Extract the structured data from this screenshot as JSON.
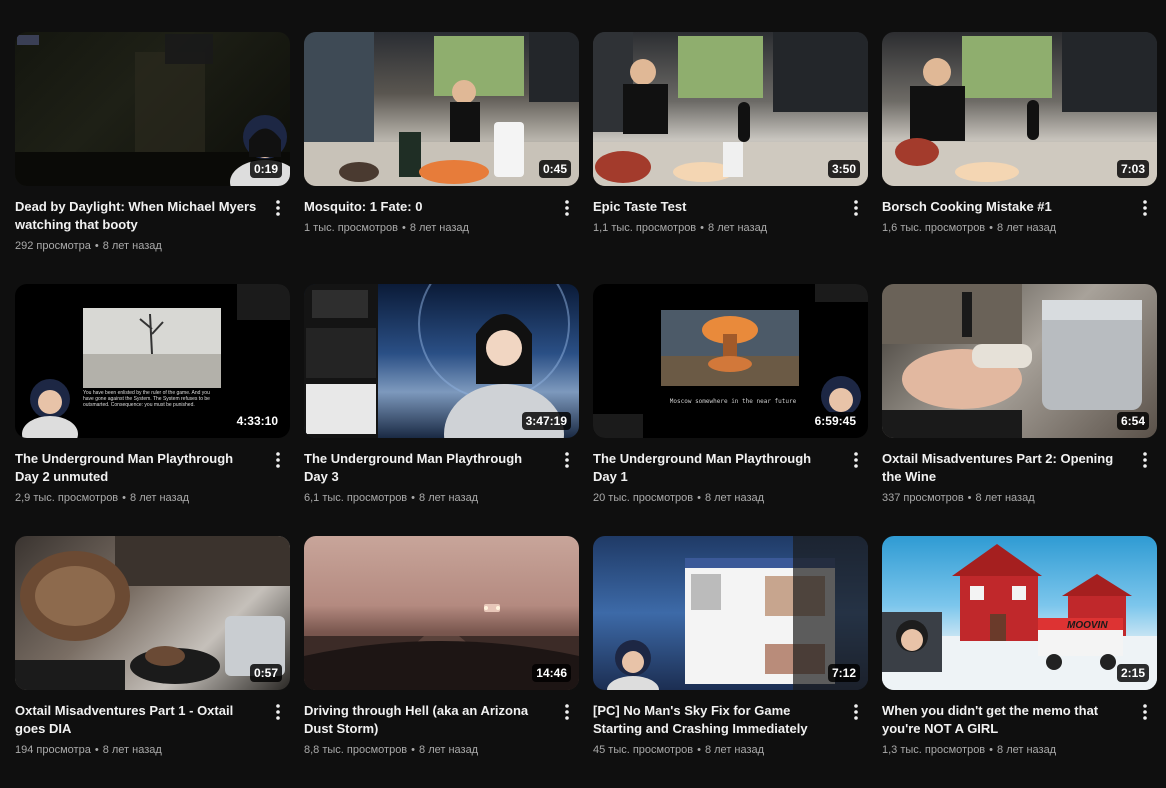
{
  "videos": [
    {
      "title": "Dead by Daylight: When Michael Myers watching that booty",
      "views": "292 просмотра",
      "age": "8 лет назад",
      "duration": "0:19"
    },
    {
      "title": "Mosquito: 1 Fate: 0",
      "views": "1 тыс. просмотров",
      "age": "8 лет назад",
      "duration": "0:45"
    },
    {
      "title": "Epic Taste Test",
      "views": "1,1 тыс. просмотров",
      "age": "8 лет назад",
      "duration": "3:50"
    },
    {
      "title": "Borsch Cooking Mistake #1",
      "views": "1,6 тыс. просмотров",
      "age": "8 лет назад",
      "duration": "7:03"
    },
    {
      "title": "The Underground Man Playthrough Day 2 unmuted",
      "views": "2,9 тыс. просмотров",
      "age": "8 лет назад",
      "duration": "4:33:10"
    },
    {
      "title": "The Underground Man Playthrough Day 3",
      "views": "6,1 тыс. просмотров",
      "age": "8 лет назад",
      "duration": "3:47:19"
    },
    {
      "title": "The Underground Man Playthrough Day 1",
      "views": "20 тыс. просмотров",
      "age": "8 лет назад",
      "duration": "6:59:45"
    },
    {
      "title": "Oxtail Misadventures Part 2: Opening the Wine",
      "views": "337 просмотров",
      "age": "8 лет назад",
      "duration": "6:54"
    },
    {
      "title": "Oxtail Misadventures Part 1 - Oxtail goes DIA",
      "views": "194 просмотра",
      "age": "8 лет назад",
      "duration": "0:57"
    },
    {
      "title": "Driving through Hell (aka an Arizona Dust Storm)",
      "views": "8,8 тыс. просмотров",
      "age": "8 лет назад",
      "duration": "14:46"
    },
    {
      "title": "[PC] No Man's Sky Fix for Game Starting and Crashing Immediately",
      "views": "45 тыс. просмотров",
      "age": "8 лет назад",
      "duration": "7:12"
    },
    {
      "title": "When you didn't get the memo that you're NOT A GIRL",
      "views": "1,3 тыс. просмотров",
      "age": "8 лет назад",
      "duration": "2:15"
    }
  ],
  "thumbnail_texts": {
    "underground_day2_caption": "You have been enlisted by the ruler of the game. And you have gone against the System. The System refuses to be outsmarted. Consequence: you must be punished.",
    "underground_day1_caption": "Moscow somewhere in the near future",
    "truck_sign": "MOOVIN"
  },
  "separator": "•",
  "icons": {
    "menu": "more-vert-icon"
  }
}
